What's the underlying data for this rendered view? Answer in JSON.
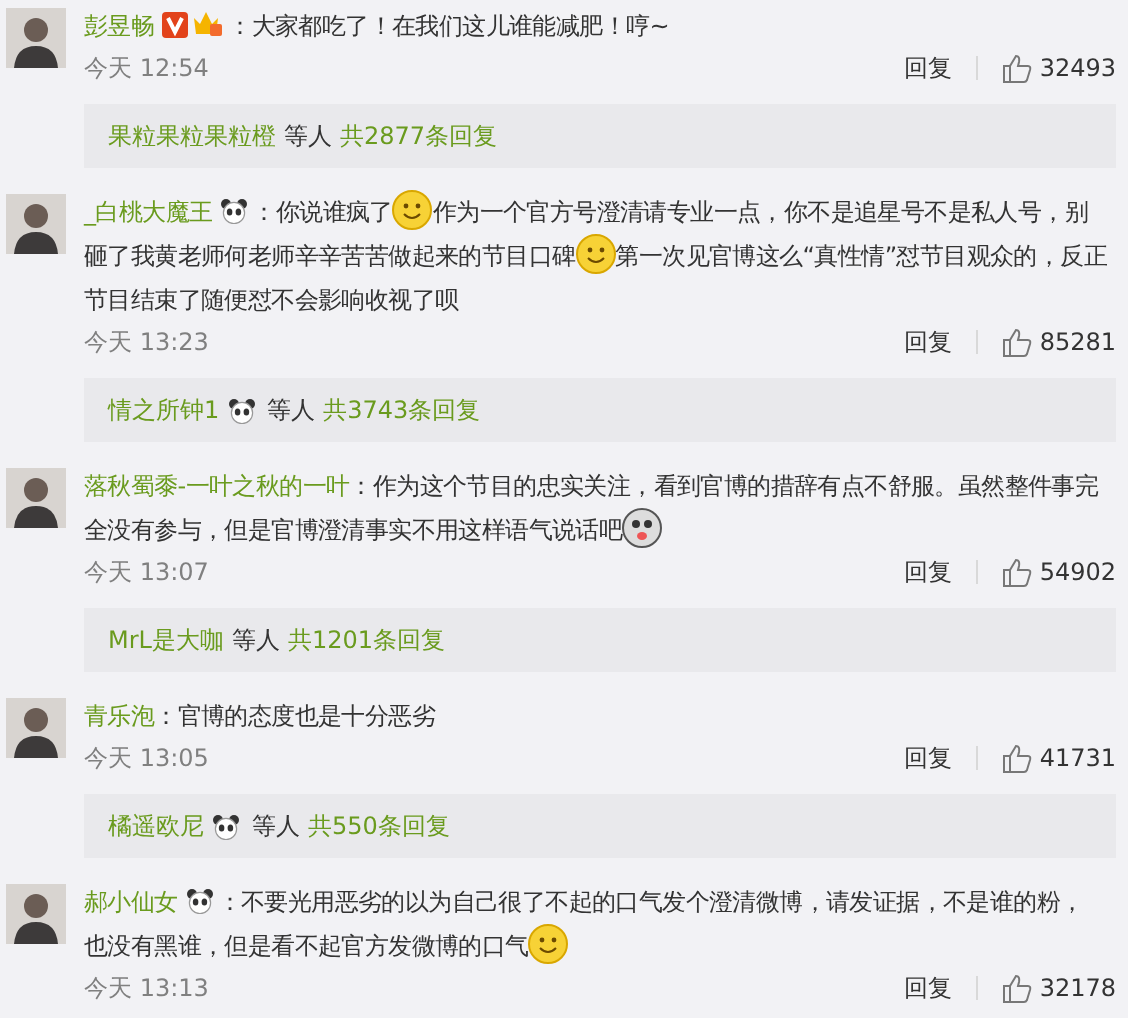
{
  "comments": [
    {
      "author": "彭昱畅",
      "badges": [
        {
          "kind": "verified"
        },
        {
          "kind": "vip"
        }
      ],
      "parts": [
        {
          "kind": "text",
          "text": "：大家都吃了！在我们这儿谁能减肥！哼~"
        }
      ],
      "time": "今天 12:54",
      "reply_label": "回复",
      "likes": "32493",
      "replies": {
        "name": "果粒果粒果粒橙",
        "others": "等人",
        "total": "共2877条回复"
      }
    },
    {
      "author": "_白桃大魔王",
      "badges": [
        {
          "kind": "panda"
        }
      ],
      "parts": [
        {
          "kind": "text",
          "text": "：你说谁疯了"
        },
        {
          "kind": "smile"
        },
        {
          "kind": "text",
          "text": "作为一个官方号澄清请专业一点，你不是追星号不是私人号，别"
        },
        {
          "kind": "text",
          "text": "砸了我黄老师何老师辛辛苦苦做起来的节目口碑"
        },
        {
          "kind": "smile"
        },
        {
          "kind": "text",
          "text": "第一次见官博这么“真性情”怼节目观众的，反正"
        },
        {
          "kind": "text",
          "text": "节目结束了随便怼不会影响收视了呗"
        }
      ],
      "time": "今天 13:23",
      "reply_label": "回复",
      "likes": "85281",
      "replies": {
        "name": "情之所钟1",
        "badges": [
          {
            "kind": "panda"
          }
        ],
        "others": "等人",
        "total": "共3743条回复"
      }
    },
    {
      "author": "落秋蜀黍-一叶之秋的一叶",
      "parts": [
        {
          "kind": "text",
          "text": "：作为这个节目的忠实关注，看到官博的措辞有点不舒服。虽然整件事完"
        },
        {
          "kind": "text",
          "text": "全没有参与，但是官博澄清事实不用这样语气说话吧"
        },
        {
          "kind": "dog"
        }
      ],
      "time": "今天 13:07",
      "reply_label": "回复",
      "likes": "54902",
      "replies": {
        "name": "MrL是大咖",
        "others": "等人",
        "total": "共1201条回复"
      }
    },
    {
      "author": "青乐泡",
      "parts": [
        {
          "kind": "text",
          "text": "：官博的态度也是十分恶劣"
        }
      ],
      "time": "今天 13:05",
      "reply_label": "回复",
      "likes": "41731",
      "replies": {
        "name": "橘遥欧尼",
        "badges": [
          {
            "kind": "panda"
          }
        ],
        "others": "等人",
        "total": "共550条回复"
      }
    },
    {
      "author": "郝小仙女",
      "badges": [
        {
          "kind": "panda"
        }
      ],
      "parts": [
        {
          "kind": "text",
          "text": "：不要光用恶劣的以为自己很了不起的口气发个澄清微博，请发证据，不是谁的粉，"
        },
        {
          "kind": "text",
          "text": "也没有黑谁，但是看不起官方发微博的口气"
        },
        {
          "kind": "smile"
        }
      ],
      "time": "今天 13:13",
      "reply_label": "回复",
      "likes": "32178"
    }
  ]
}
